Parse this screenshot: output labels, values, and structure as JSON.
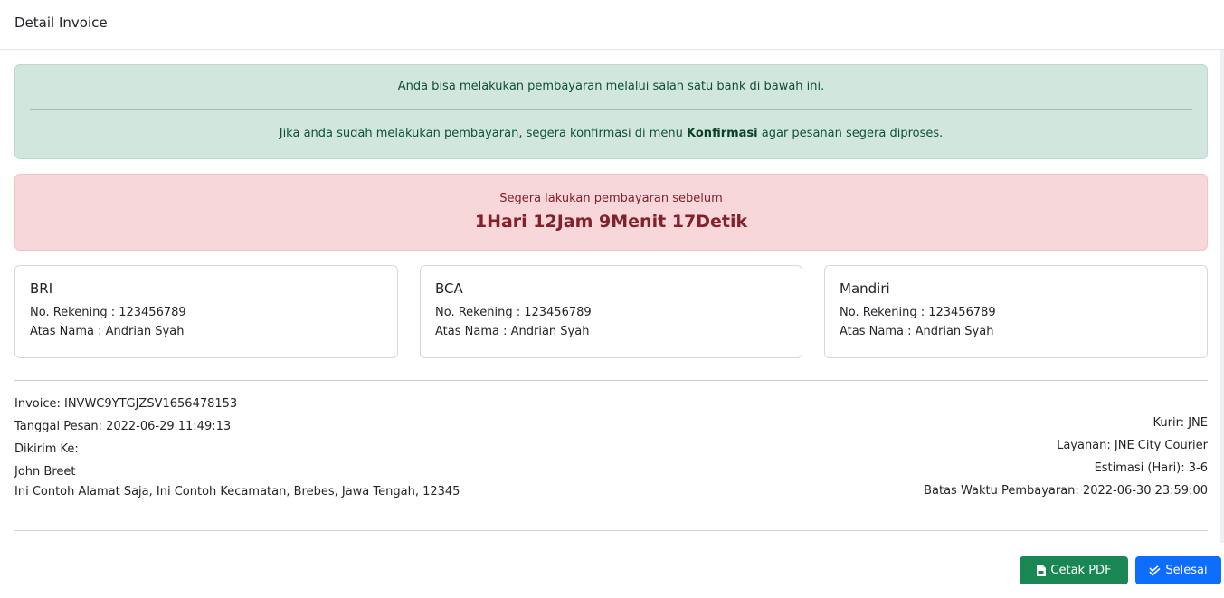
{
  "header": {
    "title": "Detail Invoice"
  },
  "payment_info": {
    "line1": "Anda bisa melakukan pembayaran melalui salah satu bank di bawah ini.",
    "line2_before": "Jika anda sudah melakukan pembayaran, segera konfirmasi di menu ",
    "line2_link": "Konfirmasi",
    "line2_after": " agar pesanan segera diproses."
  },
  "deadline": {
    "text": "Segera lakukan pembayaran sebelum",
    "countdown": "1Hari 12Jam 9Menit 17Detik"
  },
  "banks": [
    {
      "name": "BRI",
      "account": "No. Rekening : 123456789",
      "holder": "Atas Nama : Andrian Syah"
    },
    {
      "name": "BCA",
      "account": "No. Rekening : 123456789",
      "holder": "Atas Nama : Andrian Syah"
    },
    {
      "name": "Mandiri",
      "account": "No. Rekening : 123456789",
      "holder": "Atas Nama : Andrian Syah"
    }
  ],
  "order": {
    "invoice": "Invoice: INVWC9YTGJZSV1656478153",
    "order_date": "Tanggal Pesan: 2022-06-29 11:49:13",
    "ship_to_label": "Dikirim Ke:",
    "recipient": "John Breet",
    "address": "Ini Contoh Alamat Saja, Ini Contoh Kecamatan, Brebes, Jawa Tengah, 12345"
  },
  "shipping": {
    "courier": "Kurir: JNE",
    "service": "Layanan: JNE City Courier",
    "estimate": "Estimasi (Hari): 3-6",
    "payment_deadline": "Batas Waktu Pembayaran: 2022-06-30 23:59:00"
  },
  "actions": {
    "pdf_label": "Cetak PDF",
    "done_label": "Selesai"
  },
  "colors": {
    "success_bg": "#d1e7dd",
    "danger_bg": "#f8d7da",
    "btn_pdf": "#198754",
    "btn_done": "#0d6efd"
  },
  "icons": {
    "pdf": "file-pdf-icon",
    "done": "double-check-icon"
  }
}
